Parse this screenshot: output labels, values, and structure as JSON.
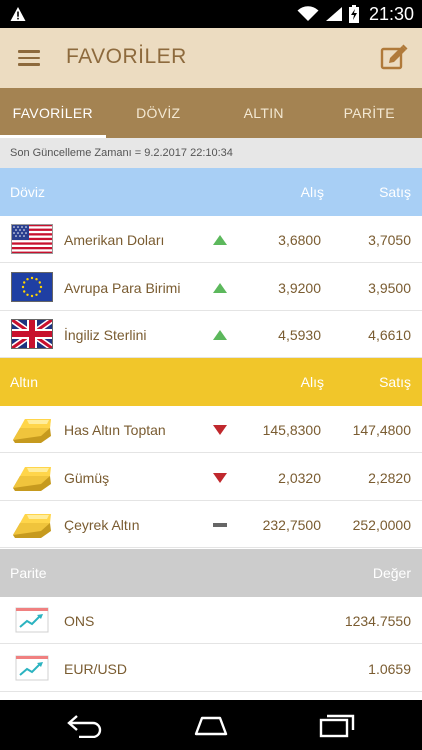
{
  "status_bar": {
    "time": "21:30"
  },
  "app_bar": {
    "title": "FAVORİLER"
  },
  "tabs": [
    {
      "label": "FAVORİLER",
      "active": true
    },
    {
      "label": "DÖVİZ",
      "active": false
    },
    {
      "label": "ALTIN",
      "active": false
    },
    {
      "label": "PARİTE",
      "active": false
    }
  ],
  "last_update": "Son Güncelleme Zamanı = 9.2.2017 22:10:34",
  "doviz": {
    "header": {
      "name": "Döviz",
      "col1": "Alış",
      "col2": "Satış"
    },
    "rows": [
      {
        "name": "Amerikan Doları",
        "icon": "us-flag-icon",
        "trend": "up",
        "buy": "3,6800",
        "sell": "3,7050"
      },
      {
        "name": "Avrupa Para Birimi",
        "icon": "eu-flag-icon",
        "trend": "up",
        "buy": "3,9200",
        "sell": "3,9500"
      },
      {
        "name": "İngiliz Sterlini",
        "icon": "uk-flag-icon",
        "trend": "up",
        "buy": "4,5930",
        "sell": "4,6610"
      }
    ]
  },
  "altin": {
    "header": {
      "name": "Altın",
      "col1": "Alış",
      "col2": "Satış"
    },
    "rows": [
      {
        "name": "Has Altın Toptan",
        "icon": "gold-bar-icon",
        "trend": "down",
        "buy": "145,8300",
        "sell": "147,4800"
      },
      {
        "name": "Gümüş",
        "icon": "gold-bar-icon",
        "trend": "down",
        "buy": "2,0320",
        "sell": "2,2820"
      },
      {
        "name": "Çeyrek Altın",
        "icon": "gold-bar-icon",
        "trend": "flat",
        "buy": "232,7500",
        "sell": "252,0000"
      }
    ]
  },
  "parite": {
    "header": {
      "name": "Parite",
      "col2": "Değer"
    },
    "rows": [
      {
        "name": "ONS",
        "icon": "line-chart-icon",
        "value": "1234.7550"
      },
      {
        "name": "EUR/USD",
        "icon": "line-chart-icon",
        "value": "1.0659"
      }
    ]
  },
  "colors": {
    "app_bar": "#ecdcc1",
    "tabs": "#a48352",
    "doviz_header": "#a8cff5",
    "altin_header": "#f1c62a",
    "parite_header": "#cccccc",
    "trend_up": "#5cb85c",
    "trend_down": "#c0282d",
    "trend_flat": "#666666"
  }
}
